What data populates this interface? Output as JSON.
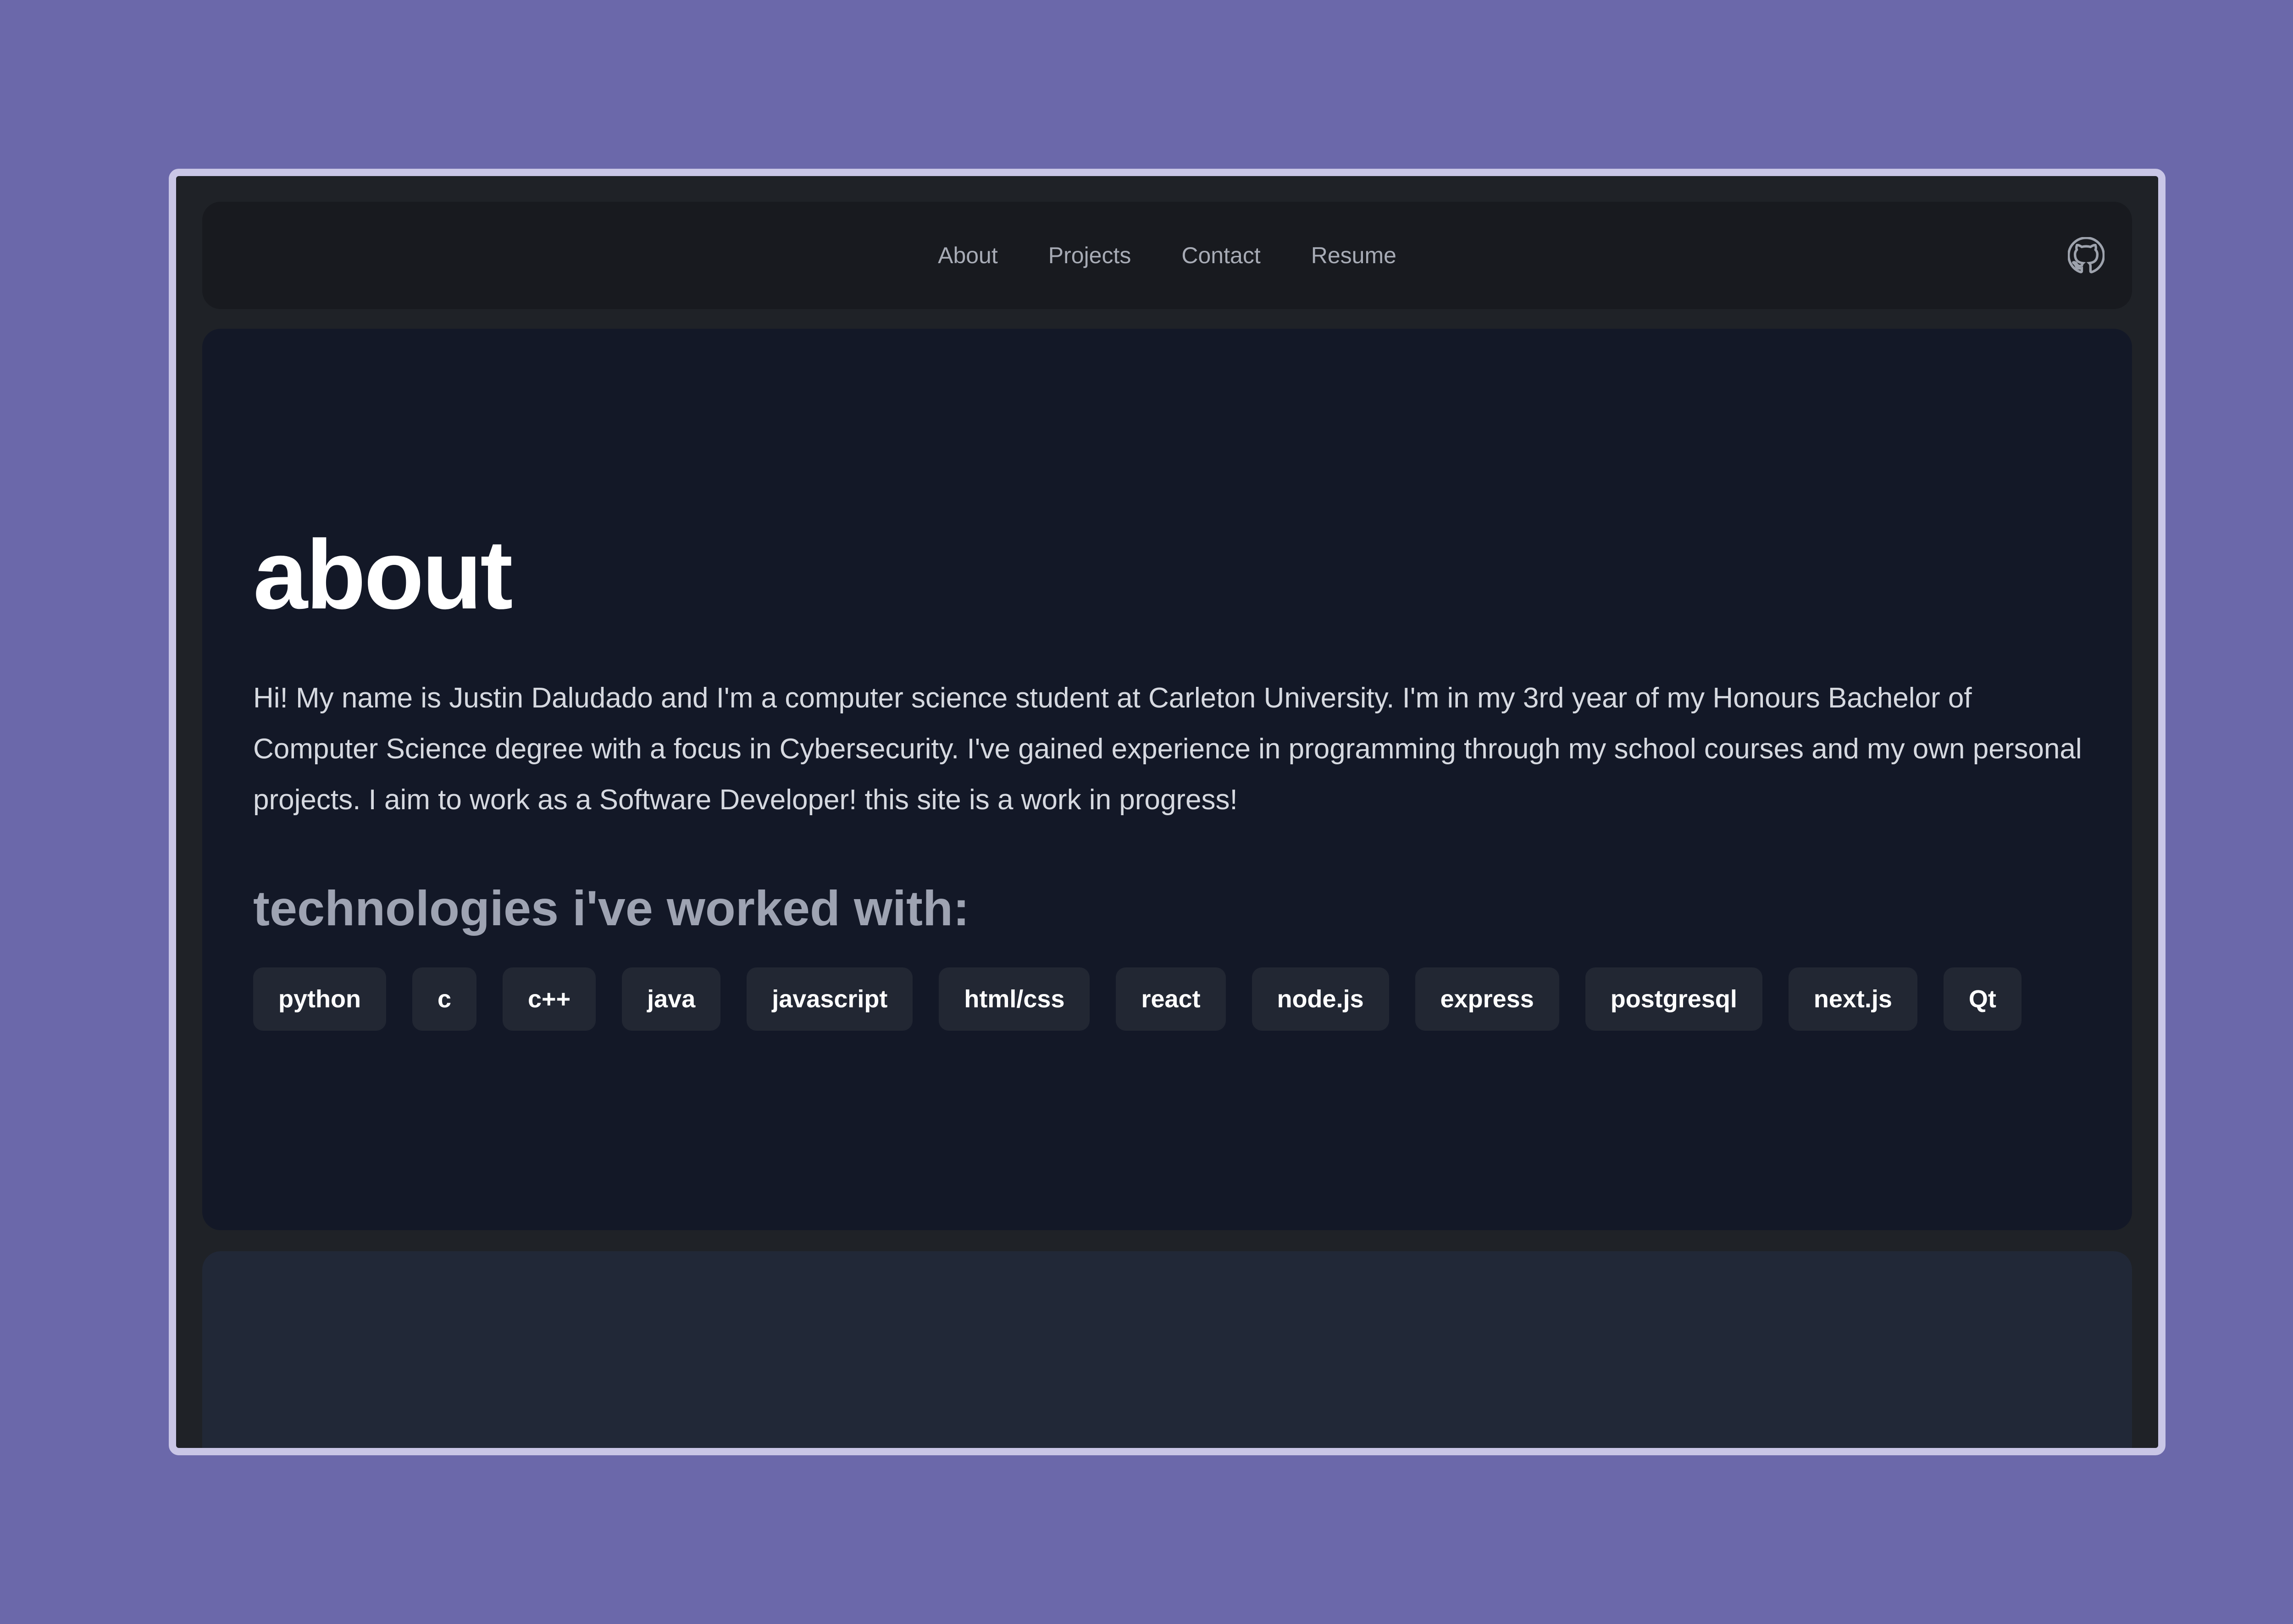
{
  "nav": {
    "links": [
      "About",
      "Projects",
      "Contact",
      "Resume"
    ],
    "github_icon": "github-icon"
  },
  "about": {
    "title": "about",
    "text": "Hi! My name is Justin Daludado and I'm a computer science student at Carleton University. I'm in my 3rd year of my Honours Bachelor of Computer Science degree with a focus in Cybersecurity. I've gained experience in programming through my school courses and my own personal projects. I aim to work as a Software Developer! this site is a work in progress!"
  },
  "technologies": {
    "title": "technologies i've worked with:",
    "items": [
      "python",
      "c",
      "c++",
      "java",
      "javascript",
      "html/css",
      "react",
      "node.js",
      "express",
      "postgresql",
      "next.js",
      "Qt"
    ]
  },
  "colors": {
    "page_background": "#6b68aa",
    "navbar": "#181a1f",
    "hero": "#131827",
    "badge": "#222733",
    "lower_panel": "#212837"
  }
}
